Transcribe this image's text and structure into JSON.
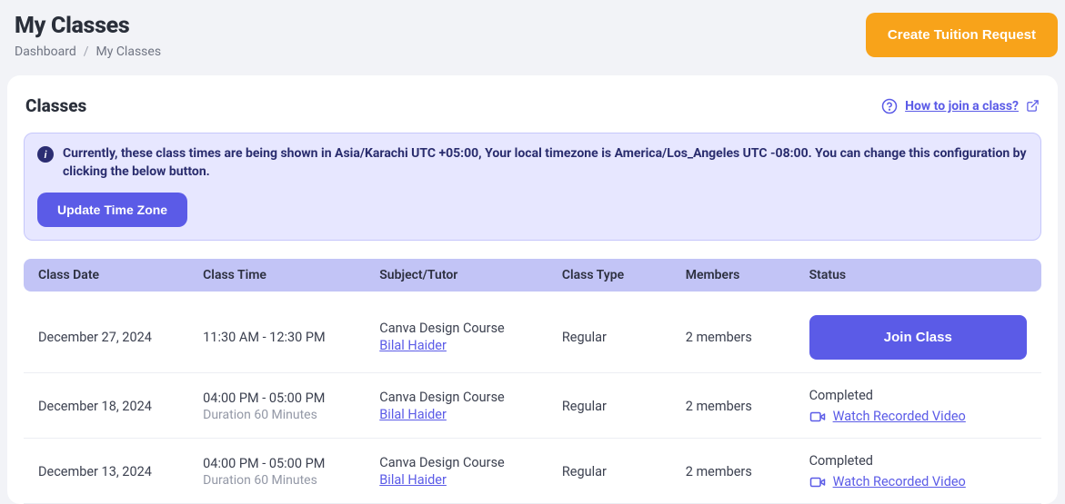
{
  "header": {
    "title": "My Classes",
    "breadcrumb": {
      "root": "Dashboard",
      "current": "My Classes"
    },
    "cta": "Create Tuition Request"
  },
  "card": {
    "title": "Classes",
    "helpText": "How to join a class?"
  },
  "notice": {
    "message": "Currently, these class times are being shown in Asia/Karachi UTC +05:00, Your local timezone is America/Los_Angeles UTC -08:00. You can change this configuration by clicking the below button.",
    "button": "Update Time Zone"
  },
  "columns": {
    "date": "Class Date",
    "time": "Class Time",
    "subject": "Subject/Tutor",
    "type": "Class Type",
    "members": "Members",
    "status": "Status"
  },
  "rows": [
    {
      "date": "December 27, 2024",
      "time": "11:30 AM - 12:30 PM",
      "duration": "",
      "subject": "Canva Design Course",
      "tutor": "Bilal Haider",
      "type": "Regular",
      "members": "2 members",
      "status": "join",
      "statusText": "",
      "actionLabel": "Join Class"
    },
    {
      "date": "December 18, 2024",
      "time": "04:00 PM - 05:00 PM",
      "duration": "Duration 60 Minutes",
      "subject": "Canva Design Course",
      "tutor": "Bilal Haider",
      "type": "Regular",
      "members": "2 members",
      "status": "completed",
      "statusText": "Completed",
      "actionLabel": "Watch Recorded Video"
    },
    {
      "date": "December 13, 2024",
      "time": "04:00 PM - 05:00 PM",
      "duration": "Duration 60 Minutes",
      "subject": "Canva Design Course",
      "tutor": "Bilal Haider",
      "type": "Regular",
      "members": "2 members",
      "status": "completed",
      "statusText": "Completed",
      "actionLabel": "Watch Recorded Video"
    }
  ]
}
